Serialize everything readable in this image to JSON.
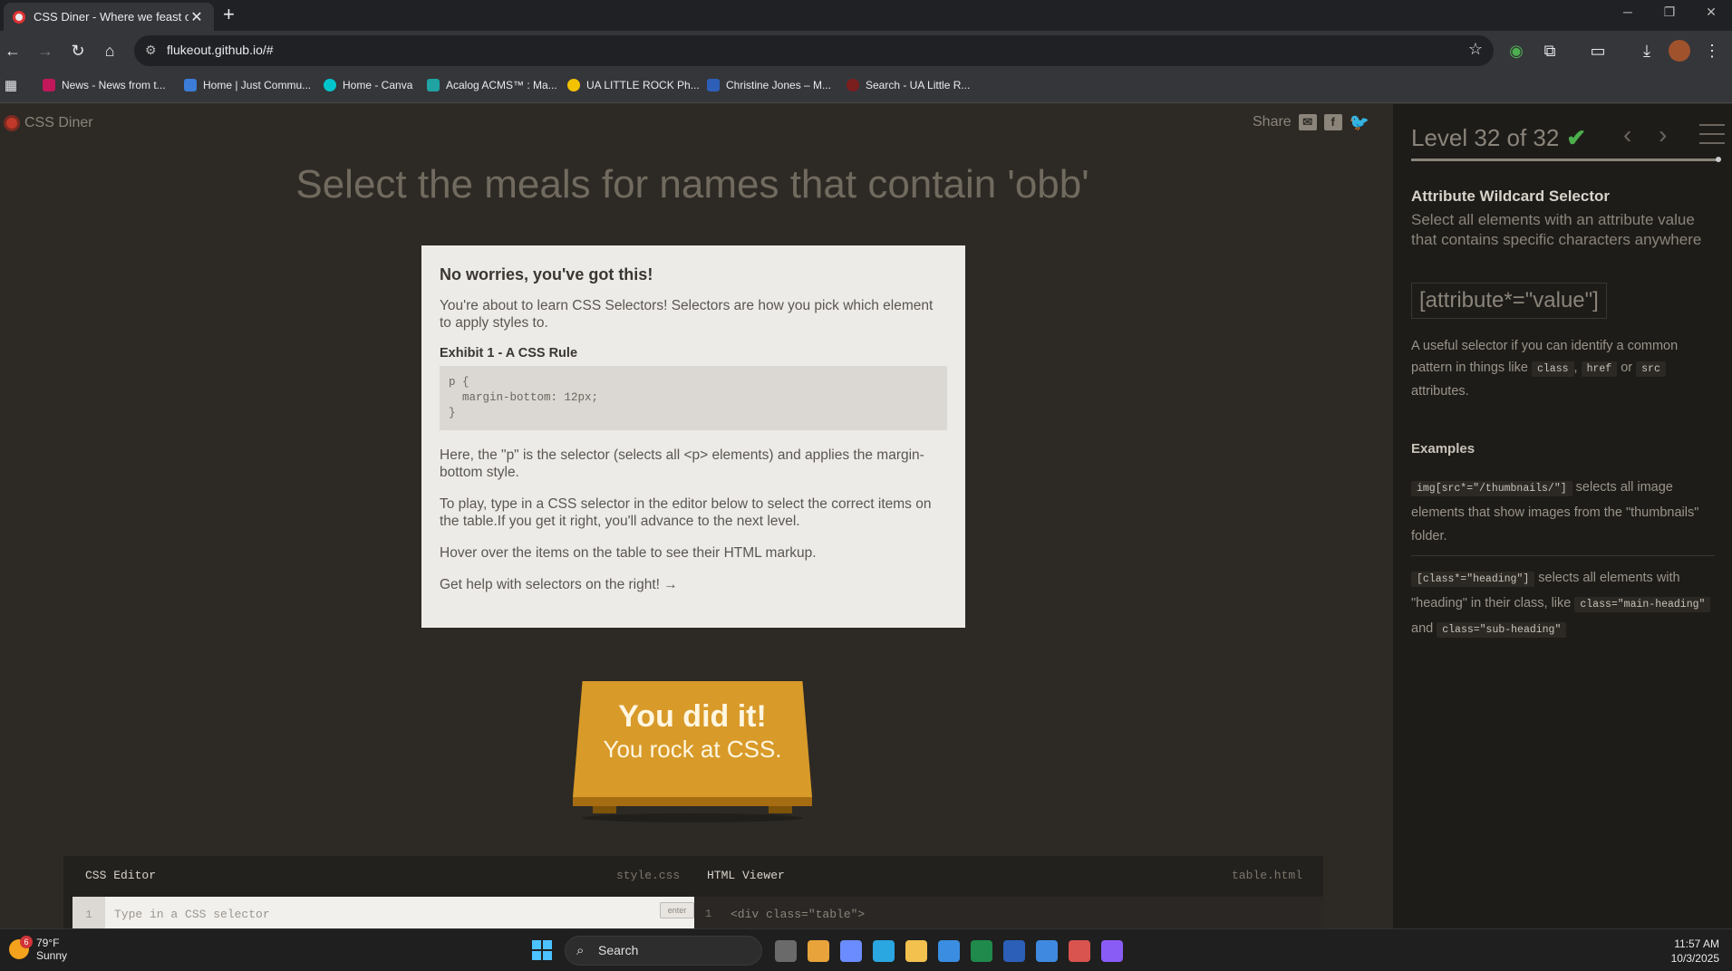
{
  "browser": {
    "tab_title": "CSS Diner - Where we feast on",
    "tab_close": "✕",
    "new_tab": "+",
    "url": "flukeout.github.io/#",
    "window_controls": [
      "─",
      "❐",
      "✕"
    ],
    "bookmarks": [
      {
        "label": "News - News from t...",
        "color": "#c2185b"
      },
      {
        "label": "Home | Just Commu...",
        "color": "#3b7dd8"
      },
      {
        "label": "Home - Canva",
        "color": "#00c4cc"
      },
      {
        "label": "Acalog ACMS™ : Ma...",
        "color": "#1fa3a3"
      },
      {
        "label": "UA LITTLE ROCK Ph...",
        "color": "#f2c200"
      },
      {
        "label": "Christine Jones – M...",
        "color": "#2d5fb8"
      },
      {
        "label": "Search - UA Little R...",
        "color": "#7b1e1e"
      }
    ]
  },
  "page": {
    "logo": "CSS Diner",
    "share_label": "Share",
    "order": "Select the meals for names that contain 'obb'"
  },
  "modal": {
    "heading": "No worries, you've got this!",
    "intro": "You're about to learn CSS Selectors! Selectors are how you pick which element to apply styles to.",
    "exhibit": "Exhibit 1 - A CSS Rule",
    "code": "p {\n  margin-bottom: 12px;\n}",
    "explain": "Here, the \"p\" is the selector (selects all <p> elements) and applies the margin-bottom style.",
    "play": "To play, type in a CSS selector in the editor below to select the correct items on the table.If you get it right, you'll advance to the next level.",
    "hover": "Hover over the items on the table to see their HTML markup.",
    "help": "Get help with selectors on the right! →"
  },
  "winner": {
    "line1": "You did it!",
    "line2": "You rock at CSS."
  },
  "editor": {
    "css_title": "CSS Editor",
    "css_file": "style.css",
    "html_title": "HTML Viewer",
    "html_file": "table.html",
    "line_number": "1",
    "placeholder": "Type in a CSS selector",
    "enter_label": "enter",
    "html_code": "<div class=\"table\">"
  },
  "sidebar": {
    "level": "Level 32 of 32",
    "check": "✔",
    "prev": "‹",
    "next": "›",
    "progress": 1.0,
    "selector_name": "Attribute Wildcard Selector",
    "hint": "Select all elements with an attribute value that contains specific characters anywhere",
    "syntax": "[attribute*=\"value\"]",
    "desc_pre": "A useful selector if you can identify a common pattern in things like",
    "desc_code1": "class",
    "desc_sep1": ",",
    "desc_code2": "href",
    "desc_or": "or",
    "desc_code3": "src",
    "desc_post": "attributes.",
    "examples_title": "Examples",
    "ex1_code": "img[src*=\"/thumbnails/\"]",
    "ex1_text": "selects all image elements that show images from the \"thumbnails\" folder.",
    "ex2_code": "[class*=\"heading\"]",
    "ex2_text": "selects all elements with \"heading\" in their class, like",
    "ex2_code2": "class=\"main-heading\"",
    "ex2_and": "and",
    "ex2_code3": "class=\"sub-heading\""
  },
  "taskbar": {
    "temp": "79°F",
    "condition": "Sunny",
    "badge": "6",
    "search": "Search",
    "time": "11:57 AM",
    "date": "10/3/2025",
    "apps": [
      {
        "name": "task-view-icon",
        "color": "#6a6a6a"
      },
      {
        "name": "chrome-icon",
        "color": "#e8a33a"
      },
      {
        "name": "copilot-icon",
        "color": "#6b8cff"
      },
      {
        "name": "cortana-icon",
        "color": "#2aa6e0"
      },
      {
        "name": "file-explorer-icon",
        "color": "#f2c14e"
      },
      {
        "name": "store-icon",
        "color": "#3a8de0"
      },
      {
        "name": "excel-icon",
        "color": "#1f8a4c"
      },
      {
        "name": "word-icon",
        "color": "#2b5fb8"
      },
      {
        "name": "todo-icon",
        "color": "#3f8ae0"
      },
      {
        "name": "snipping-icon",
        "color": "#d9534f"
      },
      {
        "name": "m365-icon",
        "color": "#8a5cf6"
      }
    ]
  }
}
